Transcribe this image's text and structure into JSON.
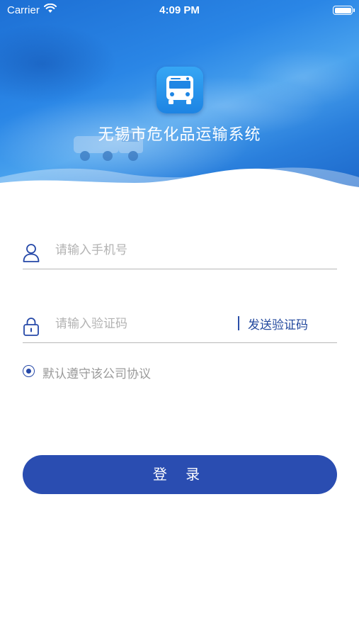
{
  "status_bar": {
    "carrier": "Carrier",
    "time": "4:09 PM",
    "icons": [
      "wifi-icon",
      "battery-icon"
    ]
  },
  "header": {
    "app_title": "无锡市危化品运输系统",
    "logo_icon": "bus-icon"
  },
  "login_form": {
    "phone": {
      "icon": "user-icon",
      "value": "",
      "placeholder": "请输入手机号"
    },
    "code": {
      "icon": "lock-icon",
      "value": "",
      "placeholder": "请输入验证码",
      "send_label": "发送验证码"
    },
    "agreement": {
      "checked": true,
      "label": "默认遵守该公司协议"
    },
    "submit_label": "登 录"
  },
  "colors": {
    "primary": "#2a4db1",
    "header_blue": "#2a86e6",
    "placeholder": "#b3b3b3",
    "agree_text": "#9a9a9a"
  }
}
